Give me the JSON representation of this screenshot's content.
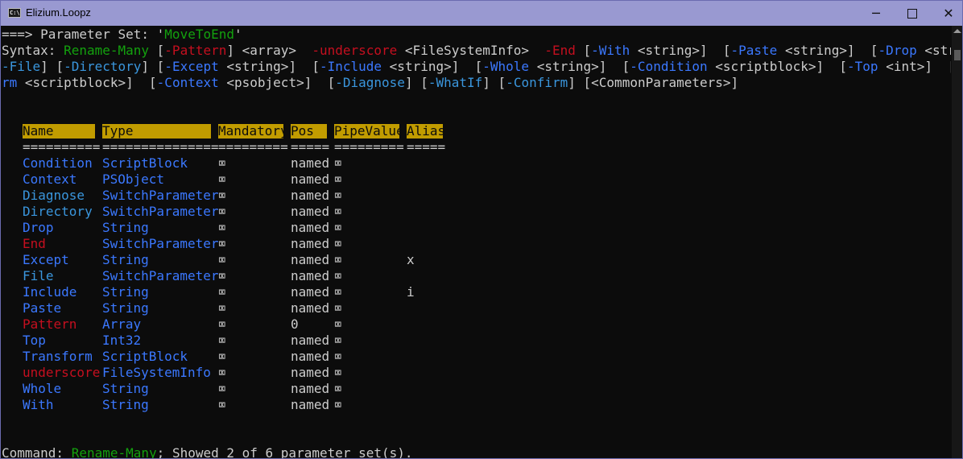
{
  "window": {
    "title": "Elizium.Loopz",
    "icon_text": "C:\\"
  },
  "controls": {
    "minimize": "─",
    "maximize": "",
    "close": "✕"
  },
  "colors": {
    "default": "#cccccc",
    "green": "#13a10e",
    "salmon": "#e74856",
    "blue": "#3b78ff",
    "cyan": "#3a96dd",
    "red": "#c50f1f",
    "header_bg": "#c19c00",
    "underscore": "#e74856"
  },
  "param_set_line": [
    {
      "t": "===> Parameter Set: ",
      "c": "default"
    },
    {
      "t": "'",
      "c": "default"
    },
    {
      "t": "MoveToEnd",
      "c": "green"
    },
    {
      "t": "'",
      "c": "default"
    }
  ],
  "syntax_lines": [
    [
      {
        "t": "Syntax: ",
        "c": "default"
      },
      {
        "t": "Rename-Many ",
        "c": "green"
      },
      {
        "t": "[",
        "c": "default"
      },
      {
        "t": "-Pattern",
        "c": "red"
      },
      {
        "t": "] ",
        "c": "default"
      },
      {
        "t": "<array> ",
        "c": "default"
      },
      {
        "t": " -underscore ",
        "c": "red"
      },
      {
        "t": "<FileSystemInfo> ",
        "c": "default"
      },
      {
        "t": " -End ",
        "c": "red"
      },
      {
        "t": "[",
        "c": "default"
      },
      {
        "t": "-With ",
        "c": "blue"
      },
      {
        "t": "<string>",
        "c": "default"
      },
      {
        "t": "]  [",
        "c": "default"
      },
      {
        "t": "-Paste ",
        "c": "blue"
      },
      {
        "t": "<string>",
        "c": "default"
      },
      {
        "t": "]  [",
        "c": "default"
      },
      {
        "t": "-Drop ",
        "c": "blue"
      },
      {
        "t": "<string>",
        "c": "default"
      },
      {
        "t": "]  [",
        "c": "default"
      }
    ],
    [
      {
        "t": "-File",
        "c": "cyan"
      },
      {
        "t": "] [",
        "c": "default"
      },
      {
        "t": "-Directory",
        "c": "cyan"
      },
      {
        "t": "] [",
        "c": "default"
      },
      {
        "t": "-Except ",
        "c": "blue"
      },
      {
        "t": "<string>",
        "c": "default"
      },
      {
        "t": "]  [",
        "c": "default"
      },
      {
        "t": "-Include ",
        "c": "blue"
      },
      {
        "t": "<string>",
        "c": "default"
      },
      {
        "t": "]  [",
        "c": "default"
      },
      {
        "t": "-Whole ",
        "c": "blue"
      },
      {
        "t": "<string>",
        "c": "default"
      },
      {
        "t": "]  [",
        "c": "default"
      },
      {
        "t": "-Condition ",
        "c": "blue"
      },
      {
        "t": "<scriptblock>",
        "c": "default"
      },
      {
        "t": "]  [",
        "c": "default"
      },
      {
        "t": "-Top ",
        "c": "blue"
      },
      {
        "t": "<int>",
        "c": "default"
      },
      {
        "t": "]  [",
        "c": "default"
      },
      {
        "t": "-Transfo",
        "c": "blue"
      }
    ],
    [
      {
        "t": "rm ",
        "c": "blue"
      },
      {
        "t": "<scriptblock>",
        "c": "default"
      },
      {
        "t": "]  [",
        "c": "default"
      },
      {
        "t": "-Context ",
        "c": "blue"
      },
      {
        "t": "<psobject>",
        "c": "default"
      },
      {
        "t": "]  [",
        "c": "default"
      },
      {
        "t": "-Diagnose",
        "c": "cyan"
      },
      {
        "t": "] [",
        "c": "default"
      },
      {
        "t": "-WhatIf",
        "c": "cyan"
      },
      {
        "t": "] [",
        "c": "default"
      },
      {
        "t": "-Confirm",
        "c": "cyan"
      },
      {
        "t": "] [",
        "c": "default"
      },
      {
        "t": "<CommonParameters>",
        "c": "default"
      },
      {
        "t": "]",
        "c": "default"
      }
    ]
  ],
  "table": {
    "headers": [
      "Name",
      "Type",
      "Mandatory",
      "Pos",
      "PipeValue",
      "Alias"
    ],
    "underline": [
      "==========",
      "===============",
      "=========",
      "=====",
      "=========",
      "====="
    ],
    "rows": [
      {
        "name": "Condition",
        "name_color": "blue",
        "type": "ScriptBlock",
        "mandatory": "⌧",
        "pos": "named",
        "pipe": "⌧",
        "alias": ""
      },
      {
        "name": "Context",
        "name_color": "blue",
        "type": "PSObject",
        "mandatory": "⌧",
        "pos": "named",
        "pipe": "⌧",
        "alias": ""
      },
      {
        "name": "Diagnose",
        "name_color": "cyan",
        "type": "SwitchParameter",
        "mandatory": "⌧",
        "pos": "named",
        "pipe": "⌧",
        "alias": ""
      },
      {
        "name": "Directory",
        "name_color": "cyan",
        "type": "SwitchParameter",
        "mandatory": "⌧",
        "pos": "named",
        "pipe": "⌧",
        "alias": ""
      },
      {
        "name": "Drop",
        "name_color": "blue",
        "type": "String",
        "mandatory": "⌧",
        "pos": "named",
        "pipe": "⌧",
        "alias": ""
      },
      {
        "name": "End",
        "name_color": "red",
        "type": "SwitchParameter",
        "mandatory": "⌧",
        "pos": "named",
        "pipe": "⌧",
        "alias": ""
      },
      {
        "name": "Except",
        "name_color": "blue",
        "type": "String",
        "mandatory": "⌧",
        "pos": "named",
        "pipe": "⌧",
        "alias": "x"
      },
      {
        "name": "File",
        "name_color": "cyan",
        "type": "SwitchParameter",
        "mandatory": "⌧",
        "pos": "named",
        "pipe": "⌧",
        "alias": ""
      },
      {
        "name": "Include",
        "name_color": "blue",
        "type": "String",
        "mandatory": "⌧",
        "pos": "named",
        "pipe": "⌧",
        "alias": "i"
      },
      {
        "name": "Paste",
        "name_color": "blue",
        "type": "String",
        "mandatory": "⌧",
        "pos": "named",
        "pipe": "⌧",
        "alias": ""
      },
      {
        "name": "Pattern",
        "name_color": "red",
        "type": "Array",
        "mandatory": "⌧",
        "pos": "0",
        "pipe": "⌧",
        "alias": ""
      },
      {
        "name": "Top",
        "name_color": "blue",
        "type": "Int32",
        "mandatory": "⌧",
        "pos": "named",
        "pipe": "⌧",
        "alias": ""
      },
      {
        "name": "Transform",
        "name_color": "blue",
        "type": "ScriptBlock",
        "mandatory": "⌧",
        "pos": "named",
        "pipe": "⌧",
        "alias": ""
      },
      {
        "name": "underscore",
        "name_color": "red",
        "type": "FileSystemInfo",
        "mandatory": "⌧",
        "pos": "named",
        "pipe": "⌧",
        "alias": ""
      },
      {
        "name": "Whole",
        "name_color": "blue",
        "type": "String",
        "mandatory": "⌧",
        "pos": "named",
        "pipe": "⌧",
        "alias": ""
      },
      {
        "name": "With",
        "name_color": "blue",
        "type": "String",
        "mandatory": "⌧",
        "pos": "named",
        "pipe": "⌧",
        "alias": ""
      }
    ]
  },
  "footer": [
    {
      "t": "Command: ",
      "c": "default"
    },
    {
      "t": "Rename-Many",
      "c": "green"
    },
    {
      "t": "; Showed 2 of 6 parameter set(s).",
      "c": "default"
    }
  ]
}
